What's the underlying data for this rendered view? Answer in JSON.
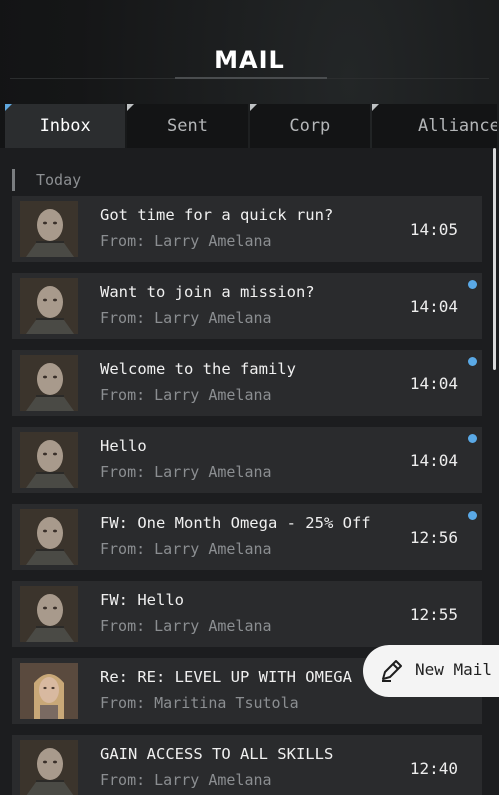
{
  "header": {
    "title": "MAIL"
  },
  "tabs": [
    {
      "label": "Inbox",
      "active": true
    },
    {
      "label": "Sent",
      "active": false
    },
    {
      "label": "Corp",
      "active": false
    },
    {
      "label": "Alliance",
      "active": false
    }
  ],
  "section": {
    "label": "Today"
  },
  "from_label": "From:",
  "messages": [
    {
      "subject": "Got time for a quick run?",
      "sender": "Larry Amelana",
      "time": "14:05",
      "unread": false,
      "avatar": "male-portrait"
    },
    {
      "subject": "Want to join a mission?",
      "sender": "Larry Amelana",
      "time": "14:04",
      "unread": true,
      "avatar": "male-portrait"
    },
    {
      "subject": "Welcome to the family",
      "sender": "Larry Amelana",
      "time": "14:04",
      "unread": true,
      "avatar": "male-portrait"
    },
    {
      "subject": "Hello",
      "sender": "Larry Amelana",
      "time": "14:04",
      "unread": true,
      "avatar": "male-portrait"
    },
    {
      "subject": "FW: One Month Omega - 25% Off",
      "sender": "Larry Amelana",
      "time": "12:56",
      "unread": true,
      "avatar": "male-portrait"
    },
    {
      "subject": "FW: Hello",
      "sender": "Larry Amelana",
      "time": "12:55",
      "unread": false,
      "avatar": "male-portrait"
    },
    {
      "subject": "Re: RE: LEVEL UP WITH OMEGA",
      "sender": "Maritina Tsutola",
      "time": "",
      "unread": false,
      "avatar": "female-portrait"
    },
    {
      "subject": "GAIN ACCESS TO ALL SKILLS",
      "sender": "Larry Amelana",
      "time": "12:40",
      "unread": false,
      "avatar": "male-portrait"
    }
  ],
  "fab": {
    "label": "New Mail",
    "icon": "pen-icon"
  },
  "colors": {
    "accent": "#5aa9e6",
    "row_bg": "#2a2b2d",
    "active_tab": "#2b2d2f"
  }
}
